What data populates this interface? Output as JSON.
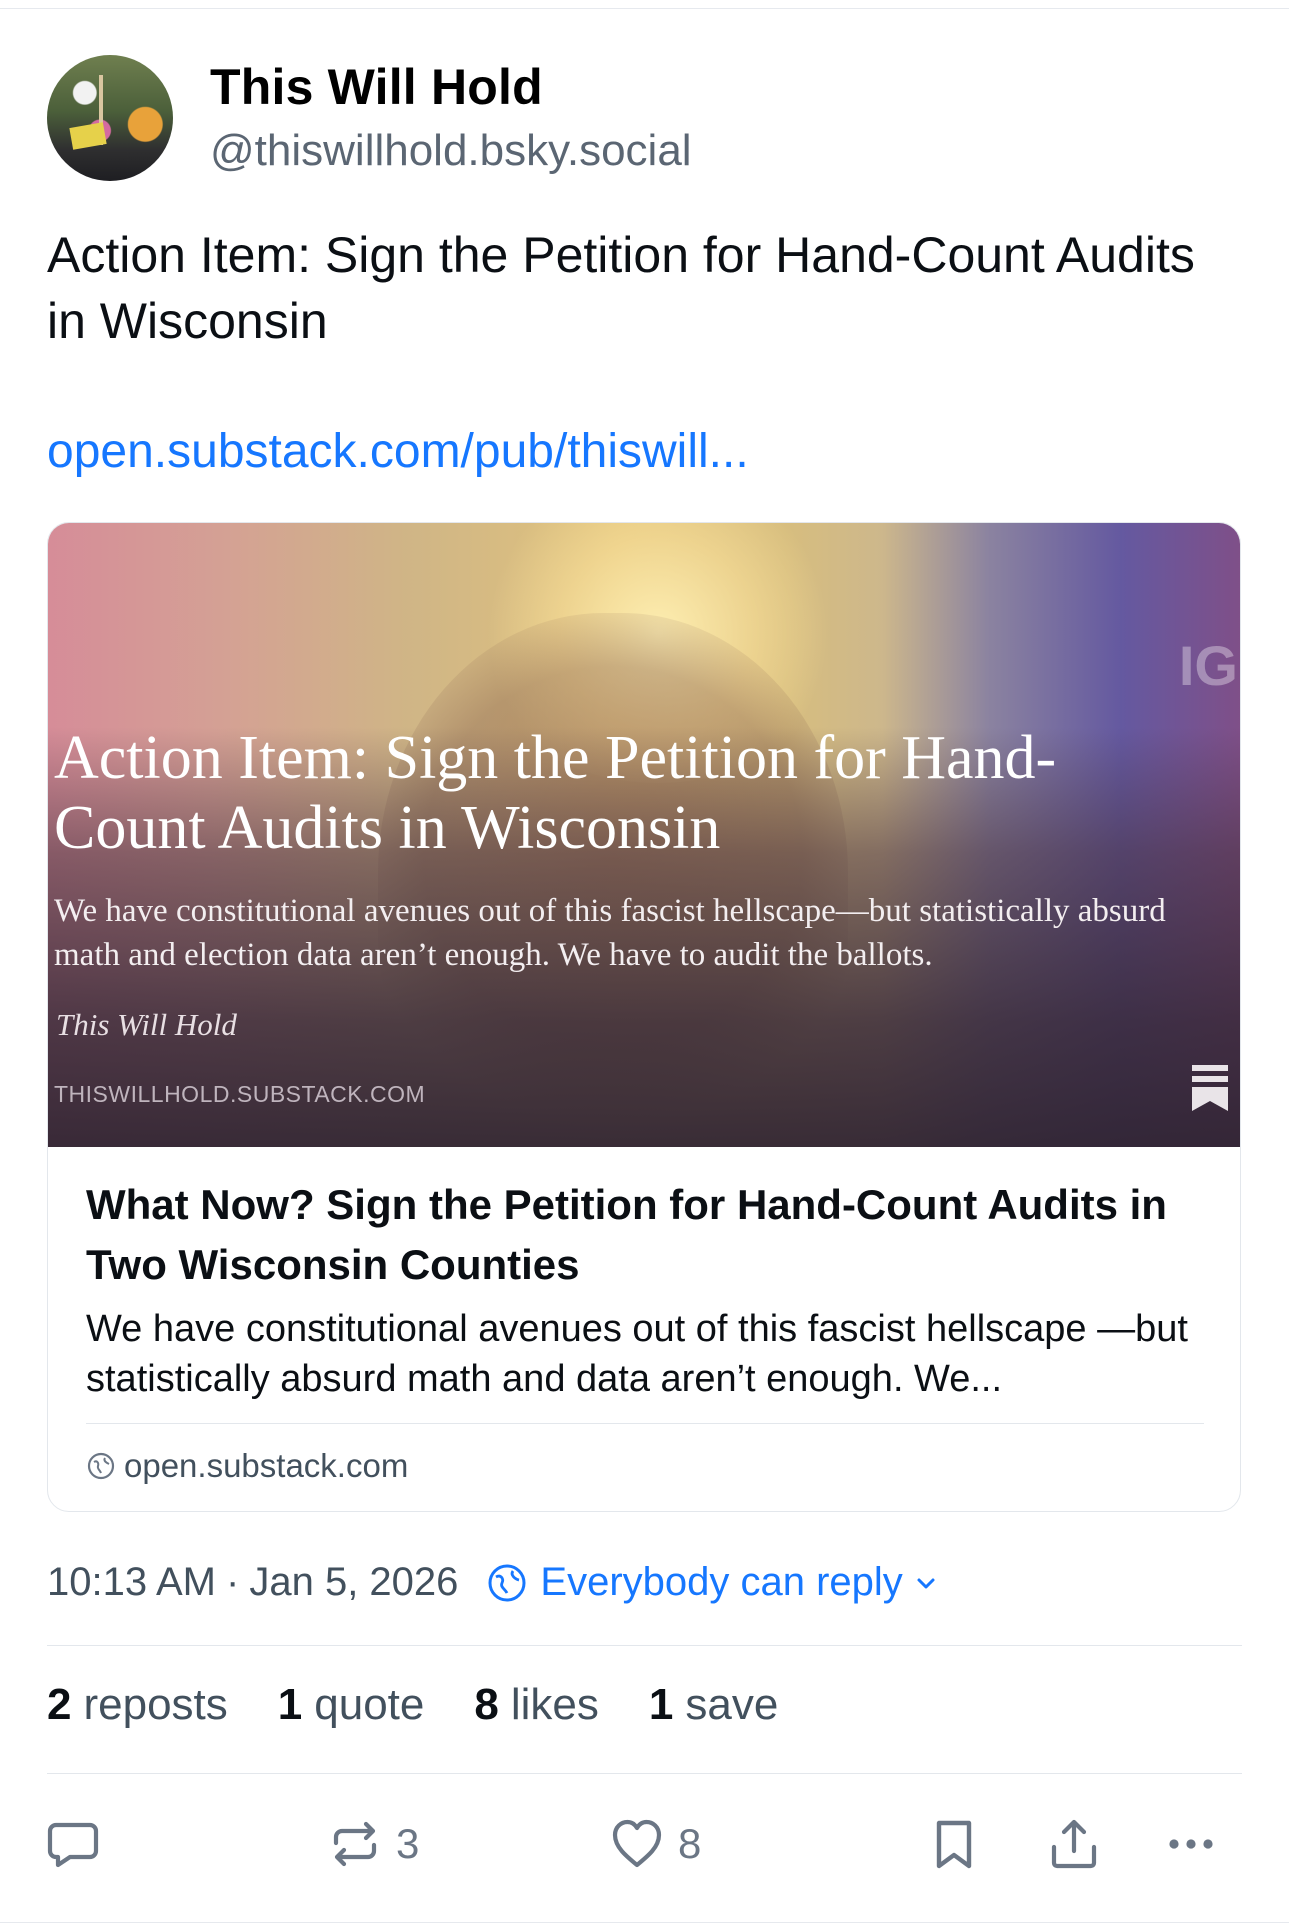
{
  "author": {
    "display_name": "This Will Hold",
    "handle": "@thiswillhold.bsky.social"
  },
  "post": {
    "text": "Action Item: Sign the Petition for Hand-Count Audits in Wisconsin",
    "link": "open.substack.com/pub/thiswill..."
  },
  "embed_card": {
    "image_overlay": {
      "title": "Action Item: Sign the Petition for Hand-Count Audits in Wisconsin",
      "description": "We have constitutional avenues out of this fascist hellscape—but statistically absurd math and election data aren’t enough. We have to audit the ballots.",
      "author": "This Will Hold",
      "domain": "THISWILLHOLD.SUBSTACK.COM"
    },
    "title": "What Now? Sign the Petition for Hand-Count Audits in Two Wisconsin Counties",
    "description": "We have constitutional avenues out of this fascist hellscape —but statistically absurd math and data aren’t enough. We...",
    "domain": "open.substack.com"
  },
  "meta": {
    "time": "10:13 AM",
    "separator": "·",
    "date": "Jan 5, 2026",
    "reply_setting": "Everybody can reply"
  },
  "stats": [
    {
      "count": "2",
      "label": "reposts"
    },
    {
      "count": "1",
      "label": "quote"
    },
    {
      "count": "8",
      "label": "likes"
    },
    {
      "count": "1",
      "label": "save"
    }
  ],
  "actions": {
    "repost_count": "3",
    "like_count": "8"
  },
  "colors": {
    "accent": "#1677ff",
    "muted_text": "#42505d",
    "icon_gray": "#6b7685",
    "divider": "#e3e7ec"
  },
  "icons": [
    "globe-icon",
    "chevron-down-icon",
    "reply-icon",
    "repost-icon",
    "like-icon",
    "bookmark-icon",
    "share-icon",
    "more-icon",
    "substack-bookmark-icon"
  ]
}
